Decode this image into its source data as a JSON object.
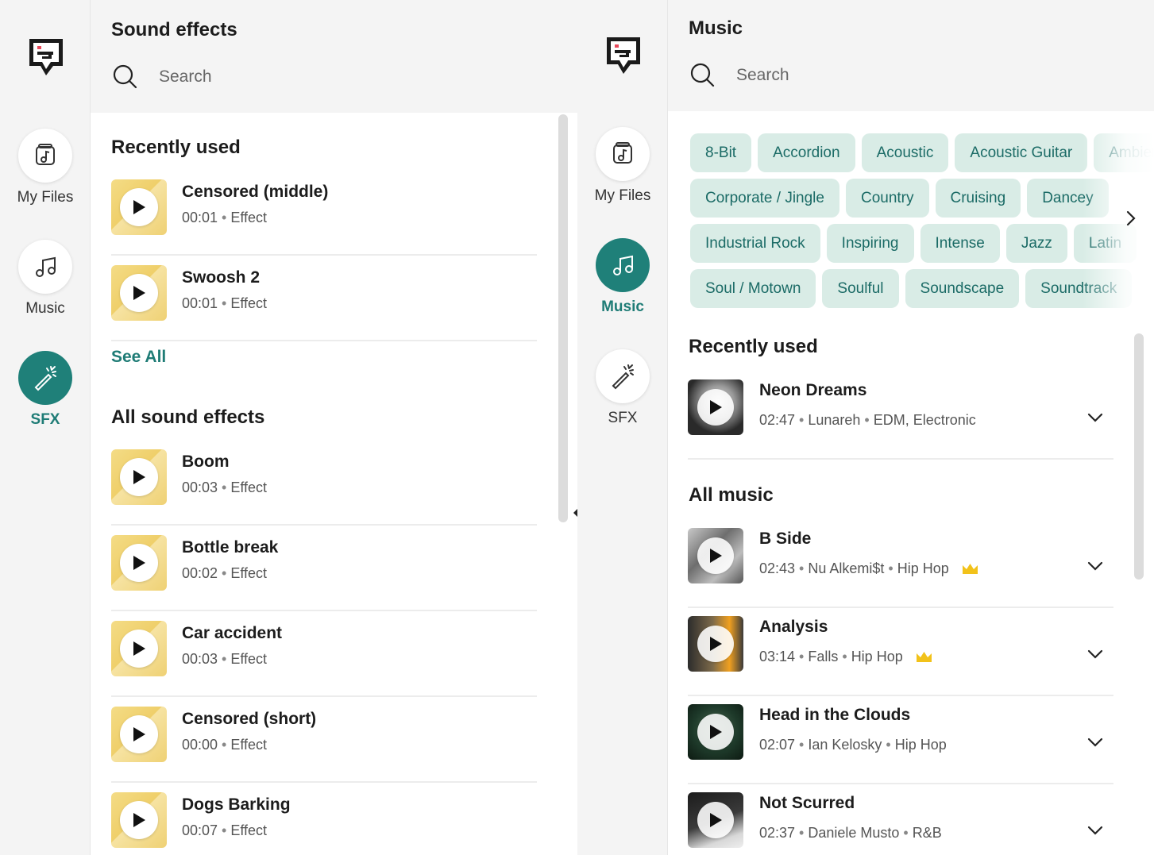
{
  "rail_left": {
    "items": [
      {
        "label": "My Files",
        "icon": "music-file-icon",
        "active": false
      },
      {
        "label": "Music",
        "icon": "music-note-icon",
        "active": false
      },
      {
        "label": "SFX",
        "icon": "magic-wand-icon",
        "active": true
      }
    ]
  },
  "rail_right": {
    "items": [
      {
        "label": "My Files",
        "icon": "music-file-icon",
        "active": false
      },
      {
        "label": "Music",
        "icon": "music-note-icon",
        "active": true
      },
      {
        "label": "SFX",
        "icon": "magic-wand-icon",
        "active": false
      }
    ]
  },
  "sfx": {
    "title": "Sound effects",
    "search_placeholder": "Search",
    "recent_title": "Recently used",
    "recent": [
      {
        "title": "Censored (middle)",
        "duration": "00:01",
        "type": "Effect"
      },
      {
        "title": "Swoosh 2",
        "duration": "00:01",
        "type": "Effect"
      }
    ],
    "see_all": "See All",
    "all_title": "All sound effects",
    "all": [
      {
        "title": "Boom",
        "duration": "00:03",
        "type": "Effect"
      },
      {
        "title": "Bottle break",
        "duration": "00:02",
        "type": "Effect"
      },
      {
        "title": "Car accident",
        "duration": "00:03",
        "type": "Effect"
      },
      {
        "title": "Censored (short)",
        "duration": "00:00",
        "type": "Effect"
      },
      {
        "title": "Dogs Barking",
        "duration": "00:07",
        "type": "Effect"
      }
    ]
  },
  "music": {
    "title": "Music",
    "search_placeholder": "Search",
    "chips": [
      [
        "8-Bit",
        "Accordion",
        "Acoustic",
        "Acoustic Guitar",
        "Ambient"
      ],
      [
        "Corporate / Jingle",
        "Country",
        "Cruising",
        "Dancey"
      ],
      [
        "Industrial Rock",
        "Inspiring",
        "Intense",
        "Jazz",
        "Latin"
      ],
      [
        "Soul / Motown",
        "Soulful",
        "Soundscape",
        "Soundtrack"
      ]
    ],
    "recent_title": "Recently used",
    "recent": [
      {
        "title": "Neon Dreams",
        "duration": "02:47",
        "artist": "Lunareh",
        "genre": "EDM, Electronic",
        "premium": false
      }
    ],
    "all_title": "All music",
    "all": [
      {
        "title": "B Side",
        "duration": "02:43",
        "artist": "Nu Alkemi$t",
        "genre": "Hip Hop",
        "premium": true
      },
      {
        "title": "Analysis",
        "duration": "03:14",
        "artist": "Falls",
        "genre": "Hip Hop",
        "premium": true
      },
      {
        "title": "Head in the Clouds",
        "duration": "02:07",
        "artist": "Ian Kelosky",
        "genre": "Hip Hop",
        "premium": false
      },
      {
        "title": "Not Scurred",
        "duration": "02:37",
        "artist": "Daniele Musto",
        "genre": "R&B",
        "premium": false
      }
    ]
  },
  "colors": {
    "accent": "#1f8079",
    "chip_bg": "#d9ece6",
    "chip_text": "#1b6b66",
    "sfx_thumb": "#f0d478",
    "crown": "#f2c21a"
  }
}
